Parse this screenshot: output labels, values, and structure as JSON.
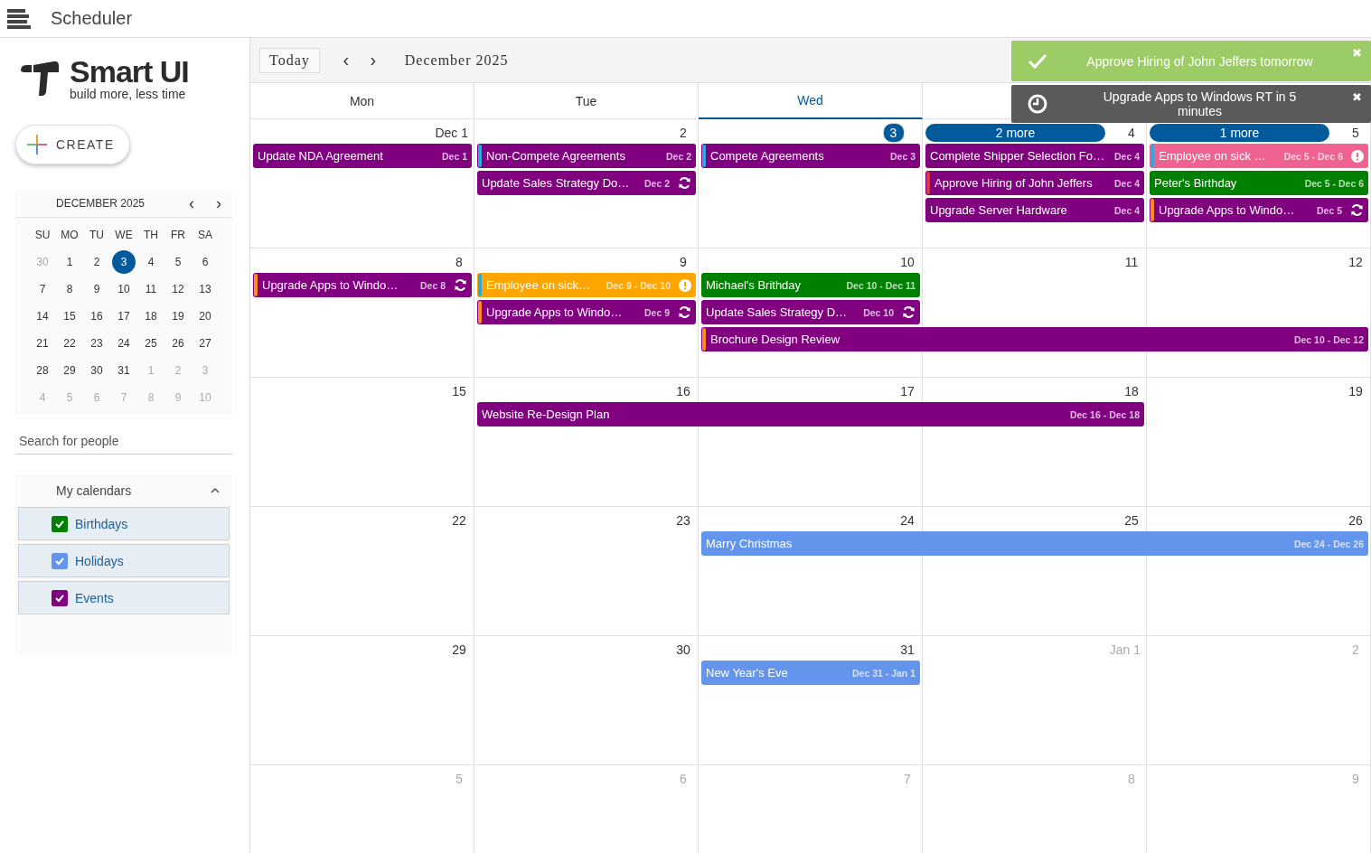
{
  "app_bar": {
    "title": "Scheduler"
  },
  "sidebar": {
    "logo": {
      "name": "Smart UI",
      "tagline": "build more, less time"
    },
    "create_button": "CREATE",
    "mini_calendar": {
      "title": "DECEMBER 2025",
      "prev": "‹",
      "next": "›",
      "weekdays": [
        "SU",
        "MO",
        "TU",
        "WE",
        "TH",
        "FR",
        "SA"
      ],
      "weeks": [
        [
          {
            "text": "30",
            "other_month": true,
            "selected": false
          },
          {
            "text": "1",
            "other_month": false,
            "selected": false
          },
          {
            "text": "2",
            "other_month": false,
            "selected": false
          },
          {
            "text": "3",
            "other_month": false,
            "selected": true
          },
          {
            "text": "4",
            "other_month": false,
            "selected": false
          },
          {
            "text": "5",
            "other_month": false,
            "selected": false
          },
          {
            "text": "6",
            "other_month": false,
            "selected": false
          }
        ],
        [
          {
            "text": "7",
            "other_month": false,
            "selected": false
          },
          {
            "text": "8",
            "other_month": false,
            "selected": false
          },
          {
            "text": "9",
            "other_month": false,
            "selected": false
          },
          {
            "text": "10",
            "other_month": false,
            "selected": false
          },
          {
            "text": "11",
            "other_month": false,
            "selected": false
          },
          {
            "text": "12",
            "other_month": false,
            "selected": false
          },
          {
            "text": "13",
            "other_month": false,
            "selected": false
          }
        ],
        [
          {
            "text": "14",
            "other_month": false,
            "selected": false
          },
          {
            "text": "15",
            "other_month": false,
            "selected": false
          },
          {
            "text": "16",
            "other_month": false,
            "selected": false
          },
          {
            "text": "17",
            "other_month": false,
            "selected": false
          },
          {
            "text": "18",
            "other_month": false,
            "selected": false
          },
          {
            "text": "19",
            "other_month": false,
            "selected": false
          },
          {
            "text": "20",
            "other_month": false,
            "selected": false
          }
        ],
        [
          {
            "text": "21",
            "other_month": false,
            "selected": false
          },
          {
            "text": "22",
            "other_month": false,
            "selected": false
          },
          {
            "text": "23",
            "other_month": false,
            "selected": false
          },
          {
            "text": "24",
            "other_month": false,
            "selected": false
          },
          {
            "text": "25",
            "other_month": false,
            "selected": false
          },
          {
            "text": "26",
            "other_month": false,
            "selected": false
          },
          {
            "text": "27",
            "other_month": false,
            "selected": false
          }
        ],
        [
          {
            "text": "28",
            "other_month": false,
            "selected": false
          },
          {
            "text": "29",
            "other_month": false,
            "selected": false
          },
          {
            "text": "30",
            "other_month": false,
            "selected": false
          },
          {
            "text": "31",
            "other_month": false,
            "selected": false
          },
          {
            "text": "1",
            "other_month": true,
            "selected": false
          },
          {
            "text": "2",
            "other_month": true,
            "selected": false
          },
          {
            "text": "3",
            "other_month": true,
            "selected": false
          }
        ],
        [
          {
            "text": "4",
            "other_month": true,
            "selected": false
          },
          {
            "text": "5",
            "other_month": true,
            "selected": false
          },
          {
            "text": "6",
            "other_month": true,
            "selected": false
          },
          {
            "text": "7",
            "other_month": true,
            "selected": false
          },
          {
            "text": "8",
            "other_month": true,
            "selected": false
          },
          {
            "text": "9",
            "other_month": true,
            "selected": false
          },
          {
            "text": "10",
            "other_month": true,
            "selected": false
          }
        ]
      ]
    },
    "search": {
      "placeholder": "Search for people"
    },
    "my_calendars": {
      "title": "My calendars",
      "expanded": true,
      "items": [
        {
          "label": "Birthdays",
          "checked": true,
          "color": "#008000"
        },
        {
          "label": "Holidays",
          "checked": true,
          "color": "#6495ed"
        },
        {
          "label": "Events",
          "checked": true,
          "color": "#800080"
        }
      ]
    }
  },
  "toolbar": {
    "today": "Today",
    "prev": "‹",
    "next": "›",
    "date": "December 2025"
  },
  "day_headers": [
    {
      "label": "Mon",
      "selected": false
    },
    {
      "label": "Tue",
      "selected": false
    },
    {
      "label": "Wed",
      "selected": true
    }
  ],
  "weeks": [
    {
      "days": [
        {
          "text": "Dec 1",
          "other_month": false,
          "today": false,
          "events": [
            {
              "title": "Update NDA Agreement",
              "dates": "Dec 1",
              "color": "#800080",
              "recurring": false,
              "alert": false
            }
          ]
        },
        {
          "text": "2",
          "other_month": false,
          "today": false,
          "events": [
            {
              "title": "Non-Compete Agreements",
              "dates": "Dec 2",
              "color": "#800080",
              "accent": {
                "color": "#29abe2"
              },
              "recurring": false,
              "alert": false
            },
            {
              "title": "Update Sales Strategy Do…",
              "dates": "Dec 2",
              "color": "#800080",
              "recurring": true,
              "alert": false
            }
          ]
        },
        {
          "text": "3",
          "other_month": false,
          "today": true,
          "events": [
            {
              "title": "Compete Agreements",
              "dates": "Dec 3",
              "color": "#800080",
              "accent": {
                "color": "#29abe2"
              },
              "recurring": false,
              "alert": false
            }
          ]
        },
        {
          "text": "4",
          "other_month": false,
          "today": false,
          "more": "2 more",
          "events": [
            {
              "title": "Complete Shipper Selection Fo…",
              "dates": "Dec 4",
              "color": "#800080",
              "recurring": false,
              "alert": false
            },
            {
              "title": "Approve Hiring of John Jeffers",
              "dates": "Dec 4",
              "color": "#800080",
              "accent": {
                "color": "#dc3545"
              },
              "recurring": false,
              "alert": false
            },
            {
              "title": "Upgrade Server Hardware",
              "dates": "Dec 4",
              "color": "#800080",
              "recurring": false,
              "alert": false
            }
          ]
        },
        {
          "text": "5",
          "other_month": false,
          "today": false,
          "more": "1 more",
          "events": [
            {
              "title": "Employee on sick …",
              "dates": "Dec 5 - Dec 6",
              "color": "#f06292",
              "accent": {
                "color": "#29abe2"
              },
              "recurring": false,
              "alert": true
            },
            {
              "title": "Peter's Birthday",
              "dates": "Dec 5 - Dec 6",
              "color": "#008000",
              "recurring": false,
              "alert": false
            },
            {
              "title": "Upgrade Apps to Windo…",
              "dates": "Dec 5",
              "color": "#800080",
              "accent": {
                "color": "#ff8c1a"
              },
              "recurring": true,
              "alert": false
            }
          ]
        }
      ]
    },
    {
      "days": [
        {
          "text": "8",
          "other_month": false,
          "today": false,
          "events": [
            {
              "title": "Upgrade Apps to Windo…",
              "dates": "Dec 8",
              "color": "#800080",
              "accent": {
                "color": "#ff8c1a"
              },
              "recurring": true,
              "alert": false
            }
          ]
        },
        {
          "text": "9",
          "other_month": false,
          "today": false,
          "events": [
            {
              "title": "Employee on sick…",
              "dates": "Dec 9 - Dec 10",
              "color": "#ffa500",
              "accent": {
                "color": "#29abe2"
              },
              "recurring": false,
              "alert": true
            },
            {
              "title": "Upgrade Apps to Windo…",
              "dates": "Dec 9",
              "color": "#800080",
              "accent": {
                "color": "#ff8c1a"
              },
              "recurring": true,
              "alert": false
            }
          ]
        },
        {
          "text": "10",
          "other_month": false,
          "today": false,
          "events": [
            {
              "title": "Michael's Brithday",
              "dates": "Dec 10 - Dec 11",
              "color": "#008000",
              "recurring": false,
              "alert": false
            },
            {
              "title": "Update Sales Strategy D…",
              "dates": "Dec 10",
              "color": "#800080",
              "recurring": true,
              "alert": false
            },
            {
              "title": "Brochure Design Review",
              "dates": "Dec 10 - Dec 12",
              "color": "#800080",
              "accent": {
                "color": "#ff8c1a"
              },
              "recurring": false,
              "alert": false
            }
          ]
        },
        {
          "text": "11",
          "other_month": false,
          "today": false
        },
        {
          "text": "12",
          "other_month": false,
          "today": false
        }
      ]
    },
    {
      "days": [
        {
          "text": "15",
          "other_month": false,
          "today": false
        },
        {
          "text": "16",
          "other_month": false,
          "today": false,
          "events": [
            {
              "title": "Website Re-Design Plan",
              "dates": "Dec 16 - Dec 18",
              "color": "#800080",
              "recurring": false,
              "alert": false
            }
          ]
        },
        {
          "text": "17",
          "other_month": false,
          "today": false
        },
        {
          "text": "18",
          "other_month": false,
          "today": false
        },
        {
          "text": "19",
          "other_month": false,
          "today": false
        }
      ]
    },
    {
      "days": [
        {
          "text": "22",
          "other_month": false,
          "today": false
        },
        {
          "text": "23",
          "other_month": false,
          "today": false
        },
        {
          "text": "24",
          "other_month": false,
          "today": false,
          "events": [
            {
              "title": "Marry Christmas",
              "dates": "Dec 24 - Dec 26",
              "color": "#6495ed",
              "recurring": false,
              "alert": false
            }
          ]
        },
        {
          "text": "25",
          "other_month": false,
          "today": false
        },
        {
          "text": "26",
          "other_month": false,
          "today": false
        }
      ]
    },
    {
      "days": [
        {
          "text": "29",
          "other_month": false,
          "today": false
        },
        {
          "text": "30",
          "other_month": false,
          "today": false
        },
        {
          "text": "31",
          "other_month": false,
          "today": false,
          "events": [
            {
              "title": "New Year's Eve",
              "dates": "Dec 31 - Jan 1",
              "color": "#6495ed",
              "recurring": false,
              "alert": false
            }
          ]
        },
        {
          "text": "Jan 1",
          "other_month": true,
          "today": false
        },
        {
          "text": "2",
          "other_month": true,
          "today": false
        }
      ]
    },
    {
      "days": [
        {
          "text": "5",
          "other_month": true,
          "today": false
        },
        {
          "text": "6",
          "other_month": true,
          "today": false
        },
        {
          "text": "7",
          "other_month": true,
          "today": false
        },
        {
          "text": "8",
          "other_month": true,
          "today": false
        },
        {
          "text": "9",
          "other_month": true,
          "today": false
        }
      ]
    }
  ],
  "toasts": [
    {
      "kind": "success",
      "text": "Approve Hiring of John Jeffers tomorrow",
      "close": "✖"
    },
    {
      "kind": "reminder",
      "text": "Upgrade Apps to Windows RT in 5 minutes",
      "close": "✖"
    }
  ]
}
